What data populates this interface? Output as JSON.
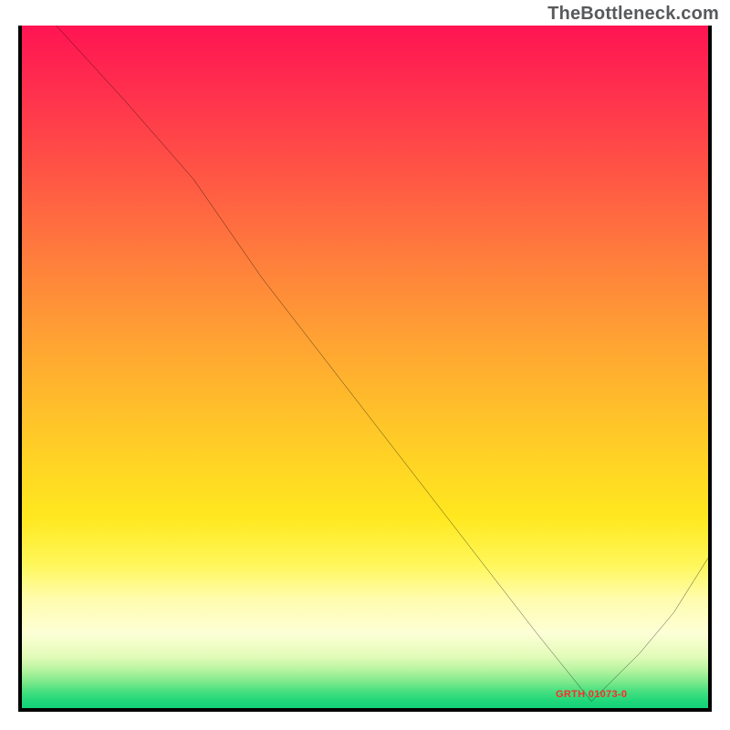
{
  "attribution": "TheBottleneck.com",
  "marker": {
    "label": "GRTH 01073-0"
  },
  "colors": {
    "curve": "#000000",
    "border": "#000000",
    "marker_text": "#ff2a2a",
    "attribution_text": "#58595b"
  },
  "chart_data": {
    "type": "line",
    "title": "",
    "xlabel": "",
    "ylabel": "",
    "xlim": [
      0,
      100
    ],
    "ylim": [
      0,
      100
    ],
    "note": "Axes are unlabeled; values are normalized 0–100 estimates read from pixel positions. The curve falls from top-left, has a slight knee near x≈25, descends near-linearly to a minimum near x≈83 (y≈1), then rises toward the right edge with another slight knee near x≈95.",
    "series": [
      {
        "name": "curve",
        "x": [
          5,
          15,
          25,
          35,
          45,
          55,
          65,
          75,
          83,
          90,
          95,
          100
        ],
        "y_from_top_pct": [
          0,
          11,
          22.5,
          37,
          50,
          63,
          76,
          89,
          99,
          92,
          86,
          78
        ],
        "y": [
          100,
          89,
          77.5,
          63,
          50,
          37,
          24,
          11,
          1,
          8,
          14,
          22
        ]
      }
    ],
    "marker": {
      "x": 83,
      "y": 1,
      "label": "GRTH 01073-0"
    },
    "gradient_bands_top_to_bottom": [
      "red",
      "orange",
      "yellow",
      "pale-yellow",
      "green"
    ]
  }
}
